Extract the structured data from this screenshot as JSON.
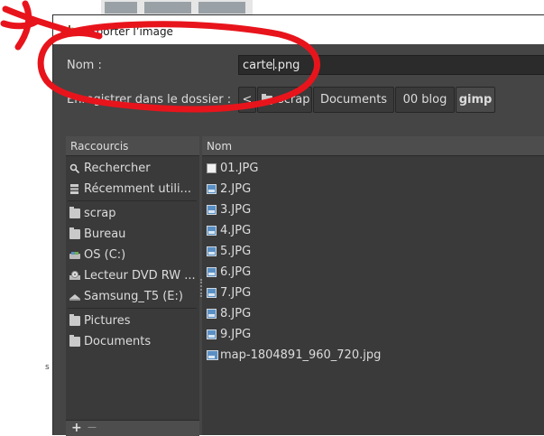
{
  "window": {
    "title": "Exporter l’image"
  },
  "form": {
    "name_label": "Nom :",
    "name_value": "carte.png",
    "name_before_caret": "carte",
    "name_after_caret": ".png",
    "folder_label": "Enregistrer dans le dossier :"
  },
  "path_bar": {
    "back_symbol": "<",
    "crumbs": [
      "scrap",
      "Documents",
      "00 blog",
      "gimp"
    ],
    "active": "gimp"
  },
  "places": {
    "header": "Raccourcis",
    "items": [
      {
        "label": "Rechercher",
        "icon": "search-icon"
      },
      {
        "label": "Récemment utili...",
        "icon": "recent-icon"
      },
      {
        "label": "scrap",
        "icon": "folder-icon"
      },
      {
        "label": "Bureau",
        "icon": "folder-icon"
      },
      {
        "label": "OS (C:)",
        "icon": "drive-icon"
      },
      {
        "label": "Lecteur DVD RW ...",
        "icon": "optical-drive-icon"
      },
      {
        "label": "Samsung_T5 (E:)",
        "icon": "external-drive-icon"
      },
      {
        "label": "Pictures",
        "icon": "folder-icon"
      },
      {
        "label": "Documents",
        "icon": "folder-icon"
      }
    ],
    "add_symbol": "+",
    "remove_symbol": "—"
  },
  "files": {
    "header": "Nom",
    "items": [
      {
        "name": "01.JPG",
        "icon": "document-icon"
      },
      {
        "name": "2.JPG",
        "icon": "image-icon"
      },
      {
        "name": "3.JPG",
        "icon": "image-icon"
      },
      {
        "name": "4.JPG",
        "icon": "image-icon"
      },
      {
        "name": "5.JPG",
        "icon": "image-icon"
      },
      {
        "name": "6.JPG",
        "icon": "image-icon"
      },
      {
        "name": "7.JPG",
        "icon": "image-icon"
      },
      {
        "name": "8.JPG",
        "icon": "image-icon"
      },
      {
        "name": "9.JPG",
        "icon": "image-icon"
      },
      {
        "name": "map-1804891_960_720.jpg",
        "icon": "image-icon"
      }
    ]
  },
  "background": {
    "edge_mark": "s"
  },
  "colors": {
    "dialog_bg": "#454545",
    "annotation": "#e8141c"
  }
}
